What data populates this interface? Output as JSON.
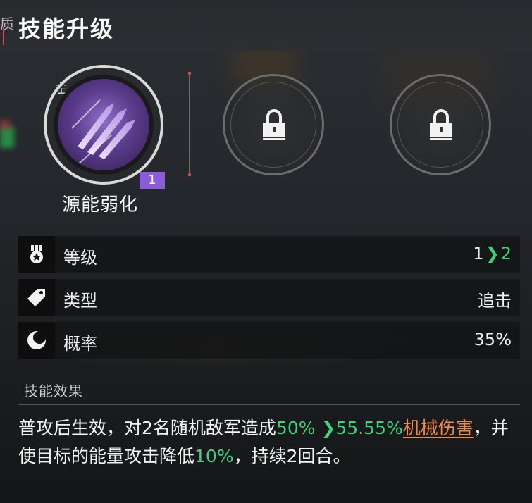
{
  "header": {
    "stub": "质",
    "title": "技能升级"
  },
  "skills": {
    "main": {
      "tag": "主",
      "name": "源能弱化",
      "level": "1"
    },
    "locked_slots": [
      {
        "icon": "lock-icon"
      },
      {
        "icon": "lock-icon"
      }
    ]
  },
  "stats": [
    {
      "icon": "medal-icon",
      "label": "等级",
      "value_old": "1",
      "value_new": "2"
    },
    {
      "icon": "tag-icon",
      "label": "类型",
      "value": "追击"
    },
    {
      "icon": "moon-icon",
      "label": "概率",
      "value": "35%"
    }
  ],
  "effect": {
    "section_title": "技能效果",
    "parts": {
      "p1": "普攻后生效，对2名随机敌军造成",
      "v1_old": "50%",
      "v1_new": "55.55%",
      "dmg_type": "机械伤害",
      "p2": "，并使目标的能量攻击降低",
      "v2": "10%",
      "p3": "，持续2回合。"
    }
  },
  "colors": {
    "accent_green": "#3fd27a",
    "accent_orange": "#ef8a4a",
    "badge_purple": "#8b5bd8",
    "accent_red": "#dd4444"
  }
}
